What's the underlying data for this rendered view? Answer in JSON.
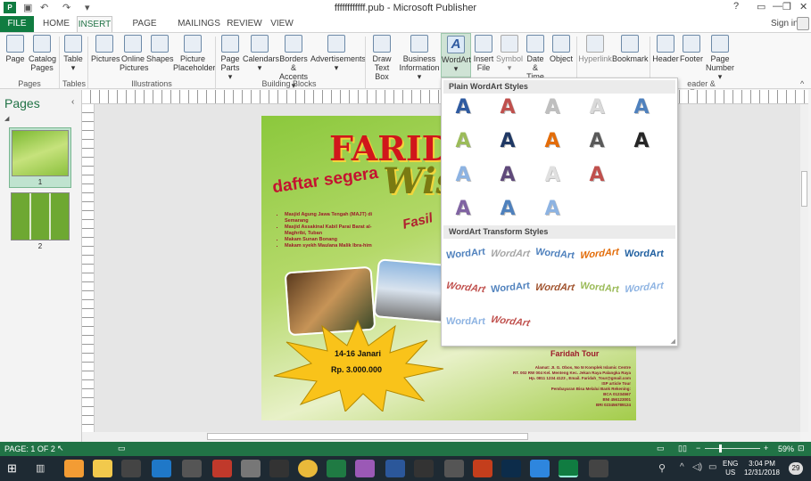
{
  "window": {
    "title": "ffffffffffff.pub - Microsoft Publisher",
    "help": "?",
    "signin": "Sign in"
  },
  "tabs": [
    "FILE",
    "HOME",
    "INSERT",
    "PAGE DESIGN",
    "MAILINGS",
    "REVIEW",
    "VIEW"
  ],
  "ribbon": {
    "buttons": [
      {
        "l1": "Page",
        "l2": ""
      },
      {
        "l1": "Catalog",
        "l2": "Pages"
      },
      {
        "l1": "Table",
        "l2": "▾"
      },
      {
        "l1": "Pictures",
        "l2": ""
      },
      {
        "l1": "Online",
        "l2": "Pictures"
      },
      {
        "l1": "Shapes",
        "l2": ""
      },
      {
        "l1": "Picture",
        "l2": "Placeholder"
      },
      {
        "l1": "Page",
        "l2": "Parts ▾"
      },
      {
        "l1": "Calendars",
        "l2": "▾"
      },
      {
        "l1": "Borders &",
        "l2": "Accents ▾"
      },
      {
        "l1": "Advertisements",
        "l2": "▾"
      },
      {
        "l1": "Draw",
        "l2": "Text Box"
      },
      {
        "l1": "Business",
        "l2": "Information ▾"
      },
      {
        "l1": "WordArt",
        "l2": "▾"
      },
      {
        "l1": "Insert",
        "l2": "File"
      },
      {
        "l1": "Symbol",
        "l2": "▾"
      },
      {
        "l1": "Date &",
        "l2": "Time"
      },
      {
        "l1": "Object",
        "l2": ""
      },
      {
        "l1": "Hyperlink",
        "l2": ""
      },
      {
        "l1": "Bookmark",
        "l2": ""
      },
      {
        "l1": "Header",
        "l2": ""
      },
      {
        "l1": "Footer",
        "l2": ""
      },
      {
        "l1": "Page",
        "l2": "Number ▾"
      }
    ],
    "groups": [
      "Pages",
      "Tables",
      "Illustrations",
      "Building Blocks",
      "eader & Footer"
    ]
  },
  "pages_pane": {
    "title": "Pages",
    "thumbs": [
      "1",
      "2"
    ]
  },
  "flyer": {
    "title1": "FARIDA",
    "title2": "Wis",
    "daftar": "daftar segera",
    "fasil": "Fasil",
    "bullets": [
      "Masjid Agung Jawa Tengah (MAJT) di Semarang",
      "Masjid Assakinal Kabil Parai Barat al-Maghribi, Tuban",
      "Makam Sunan Bonang",
      "Makam syekh Maulana Malik Ibra-him"
    ],
    "date": "14-16 Janari",
    "price": "Rp. 3.000.000",
    "company": "Faridah Tour",
    "contact": [
      "Alamat: JI. G. Obos, No 5I Komplek Islamic Centre",
      "RT. 002 RW 004 Kel. Menteng Kec. Jekan Raya Palangka Raya",
      "Hp. 0811 1234 4123 , Email. Faridah_Tour@gmail.com",
      "ISP article Tour",
      "Pembayaran Bisa Melalui Bank Rekening:",
      "BCA 01234567",
      "BNI 456123001",
      "BRI 023456789124"
    ]
  },
  "wordart": {
    "plain_title": "Plain WordArt Styles",
    "plain_colors": [
      "#2e5aa0",
      "#c0504d",
      "#bfbfbf",
      "#d9d9d9",
      "#4f81bd",
      "#9bbb59",
      "#1f3864",
      "#e36c09",
      "#595959",
      "#262626",
      "#8db3e2",
      "#5f497a",
      "#e0e0e0",
      "#c0504d",
      "",
      "#8064a2",
      "#4f81bd",
      "#8db3e2",
      "",
      ""
    ],
    "glyph": "A",
    "transform_title": "WordArt Transform Styles",
    "transform_items": [
      "WordArt",
      "WordArt",
      "WordArt",
      "WordArt",
      "WordArt",
      "WordArt",
      "WordArt",
      "WordArt",
      "WordArt",
      "WordArt",
      "WordArt",
      "WordArt"
    ],
    "transform_colors": [
      "#4f81bd",
      "#a6a6a6",
      "#4f81bd",
      "#e36c09",
      "#1f5fa0",
      "#c0504d",
      "#4f81bd",
      "#a0522d",
      "#9bbb59",
      "#8db3e2",
      "#8db3e2",
      "#c0504d"
    ]
  },
  "status": {
    "page": "PAGE: 1 OF 2",
    "zoom": "59%"
  },
  "taskbar": {
    "lang": "ENG",
    "region": "US",
    "time": "3:04 PM",
    "date": "12/31/2018",
    "badge": "29"
  }
}
